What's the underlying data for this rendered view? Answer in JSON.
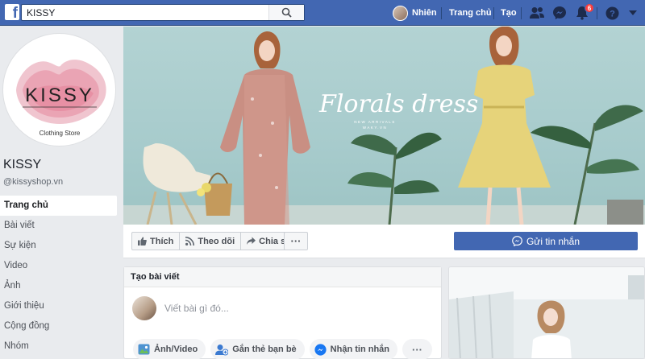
{
  "topbar": {
    "search_value": "KISSY",
    "user_name": "Nhiên",
    "home_label": "Trang chủ",
    "create_label": "Tạo",
    "notification_count": "6"
  },
  "page": {
    "logo_text": "KISSY",
    "logo_subtitle": "Clothing Store",
    "name": "KISSY",
    "handle": "@kissyshop.vn"
  },
  "left_nav": {
    "items": [
      {
        "label": "Trang chủ",
        "active": true
      },
      {
        "label": "Bài viết"
      },
      {
        "label": "Sự kiện"
      },
      {
        "label": "Video"
      },
      {
        "label": "Ảnh"
      },
      {
        "label": "Giới thiệu"
      },
      {
        "label": "Cộng đồng"
      },
      {
        "label": "Nhóm"
      }
    ]
  },
  "cover": {
    "headline": "Florals dress",
    "subtext_1": "NEW ARRIVALS",
    "subtext_2": "WAKY.VN"
  },
  "actions": {
    "like": "Thích",
    "follow": "Theo dõi",
    "share": "Chia sẻ",
    "more": "···",
    "send_message": "Gửi tin nhắn"
  },
  "create_post": {
    "header": "Tạo bài viết",
    "placeholder": "Viết bài gì đó...",
    "photo_video": "Ảnh/Video",
    "tag_friends": "Gắn thẻ bạn bè",
    "send_message": "Nhận tin nhắn",
    "more": "···"
  },
  "colors": {
    "brand_blue": "#4267b2",
    "background": "#e9ebee",
    "notification_red": "#fa3e3e"
  }
}
